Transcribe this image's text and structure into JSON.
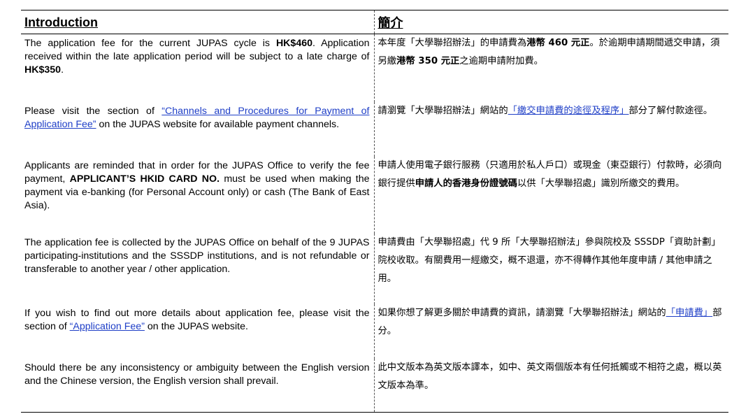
{
  "header": {
    "en": "Introduction",
    "zh": "簡介"
  },
  "rows": [
    {
      "en": [
        {
          "t": "The application fee for the current JUPAS cycle is "
        },
        {
          "t": "HK$460",
          "b": true
        },
        {
          "t": ". Application received within the late application period will be subject to a late charge of "
        },
        {
          "t": "HK$350",
          "b": true
        },
        {
          "t": "."
        }
      ],
      "zh": [
        {
          "t": "本年度「大學聯招辦法」的申請費為"
        },
        {
          "t": "港幣 460 元正",
          "b": true
        },
        {
          "t": "。於逾期申請期間遞交申請，須另繳"
        },
        {
          "t": "港幣 350 元正",
          "b": true
        },
        {
          "t": "之逾期申請附加費。"
        }
      ],
      "h": 97
    },
    {
      "en": [
        {
          "t": "Please visit the section of "
        },
        {
          "t": "“Channels and Procedures for Payment of Application Fee”",
          "link": true
        },
        {
          "t": " on the JUPAS website for available payment channels."
        }
      ],
      "zh": [
        {
          "t": "請瀏覽「大學聯招辦法」網站的"
        },
        {
          "t": "「繳交申請費的途徑及程序」",
          "link": true
        },
        {
          "t": "部分了解付款途徑。"
        }
      ],
      "h": 78
    },
    {
      "en": [
        {
          "t": "Applicants are reminded that in order for the JUPAS Office to verify the fee payment, "
        },
        {
          "t": "APPLICANT’S HKID CARD NO.",
          "b": true
        },
        {
          "t": " must be used when making the payment via e-banking (for Personal Account only) or cash (The Bank of East Asia)."
        }
      ],
      "zh": [
        {
          "t": "申請人使用電子銀行服務（只適用於私人戶口）或現金（東亞銀行）付款時，必須向銀行提供"
        },
        {
          "t": "申請人的香港身份證號碼",
          "b": true
        },
        {
          "t": "以供「大學聯招處」識別所繳交的費用。"
        }
      ],
      "h": 110
    },
    {
      "en": [
        {
          "t": "The application fee is collected by the JUPAS Office on behalf of the 9 JUPAS participating-institutions and the SSSDP institutions, and is not refundable or transferable to another year / other application."
        }
      ],
      "zh": [
        {
          "t": "申請費由「大學聯招處」代 9 所「大學聯招辦法」參與院校及 SSSDP「資助計劃」院校收取。有關費用一經繳交，概不退還，亦不得轉作其他年度申請 / 其他申請之用。"
        }
      ],
      "h": 101
    },
    {
      "en": [
        {
          "t": "If you wish to find out more details about application fee, please visit the section of "
        },
        {
          "t": "“Application Fee”",
          "link": true
        },
        {
          "t": " on the JUPAS website."
        }
      ],
      "zh": [
        {
          "t": "如果你想了解更多關於申請費的資訊，請瀏覽「大學聯招辦法」網站的"
        },
        {
          "t": "「申請費」",
          "link": true
        },
        {
          "t": "部分。"
        }
      ],
      "h": 78
    },
    {
      "en": [
        {
          "t": "Should there be any inconsistency or ambiguity between the English version and the Chinese version, the English version shall prevail."
        }
      ],
      "zh": [
        {
          "t": "此中文版本為英文版本譯本，如中、英文兩個版本有任何抵觸或不相符之處，概以英文版本為準。"
        }
      ],
      "h": 77
    }
  ]
}
